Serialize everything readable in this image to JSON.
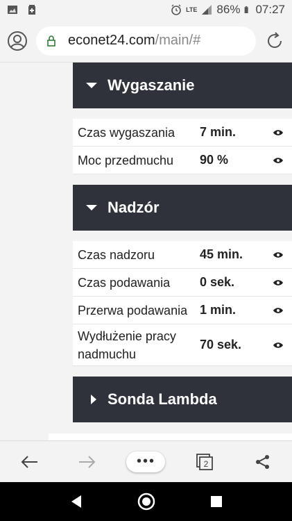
{
  "status_bar": {
    "battery": "86%",
    "time": "07:27",
    "lte": "LTE"
  },
  "browser": {
    "url_domain": "econet24.com",
    "url_path": "/main/#",
    "tab_count": "2",
    "menu_label": "•••"
  },
  "sections": [
    {
      "title": "Wygaszanie",
      "expanded": true,
      "rows": [
        {
          "label": "Czas wygaszania",
          "value": "7 min."
        },
        {
          "label": "Moc przedmuchu",
          "value": "90 %"
        }
      ]
    },
    {
      "title": "Nadzór",
      "expanded": true,
      "rows": [
        {
          "label": "Czas nadzoru",
          "value": "45 min."
        },
        {
          "label": "Czas podawania",
          "value": "0 sek."
        },
        {
          "label": "Przerwa podawania",
          "value": "1 min."
        },
        {
          "label": "Wydłużenie pracy nadmuchu",
          "value": "70 sek."
        }
      ]
    },
    {
      "title": "Sonda Lambda",
      "expanded": false,
      "rows": []
    }
  ],
  "colors": {
    "header_bg": "#2f323b",
    "lock_green": "#2e7d32"
  },
  "icons": {
    "status_left": [
      "image-icon",
      "battery-saver-icon"
    ],
    "status_right": [
      "alarm-icon",
      "signal-icon",
      "battery-icon"
    ],
    "toolbar": [
      "back-arrow-icon",
      "forward-arrow-icon",
      "menu-dots-icon",
      "tabs-icon",
      "share-icon"
    ],
    "navbar": [
      "nav-back-icon",
      "nav-home-icon",
      "nav-recents-icon"
    ]
  }
}
